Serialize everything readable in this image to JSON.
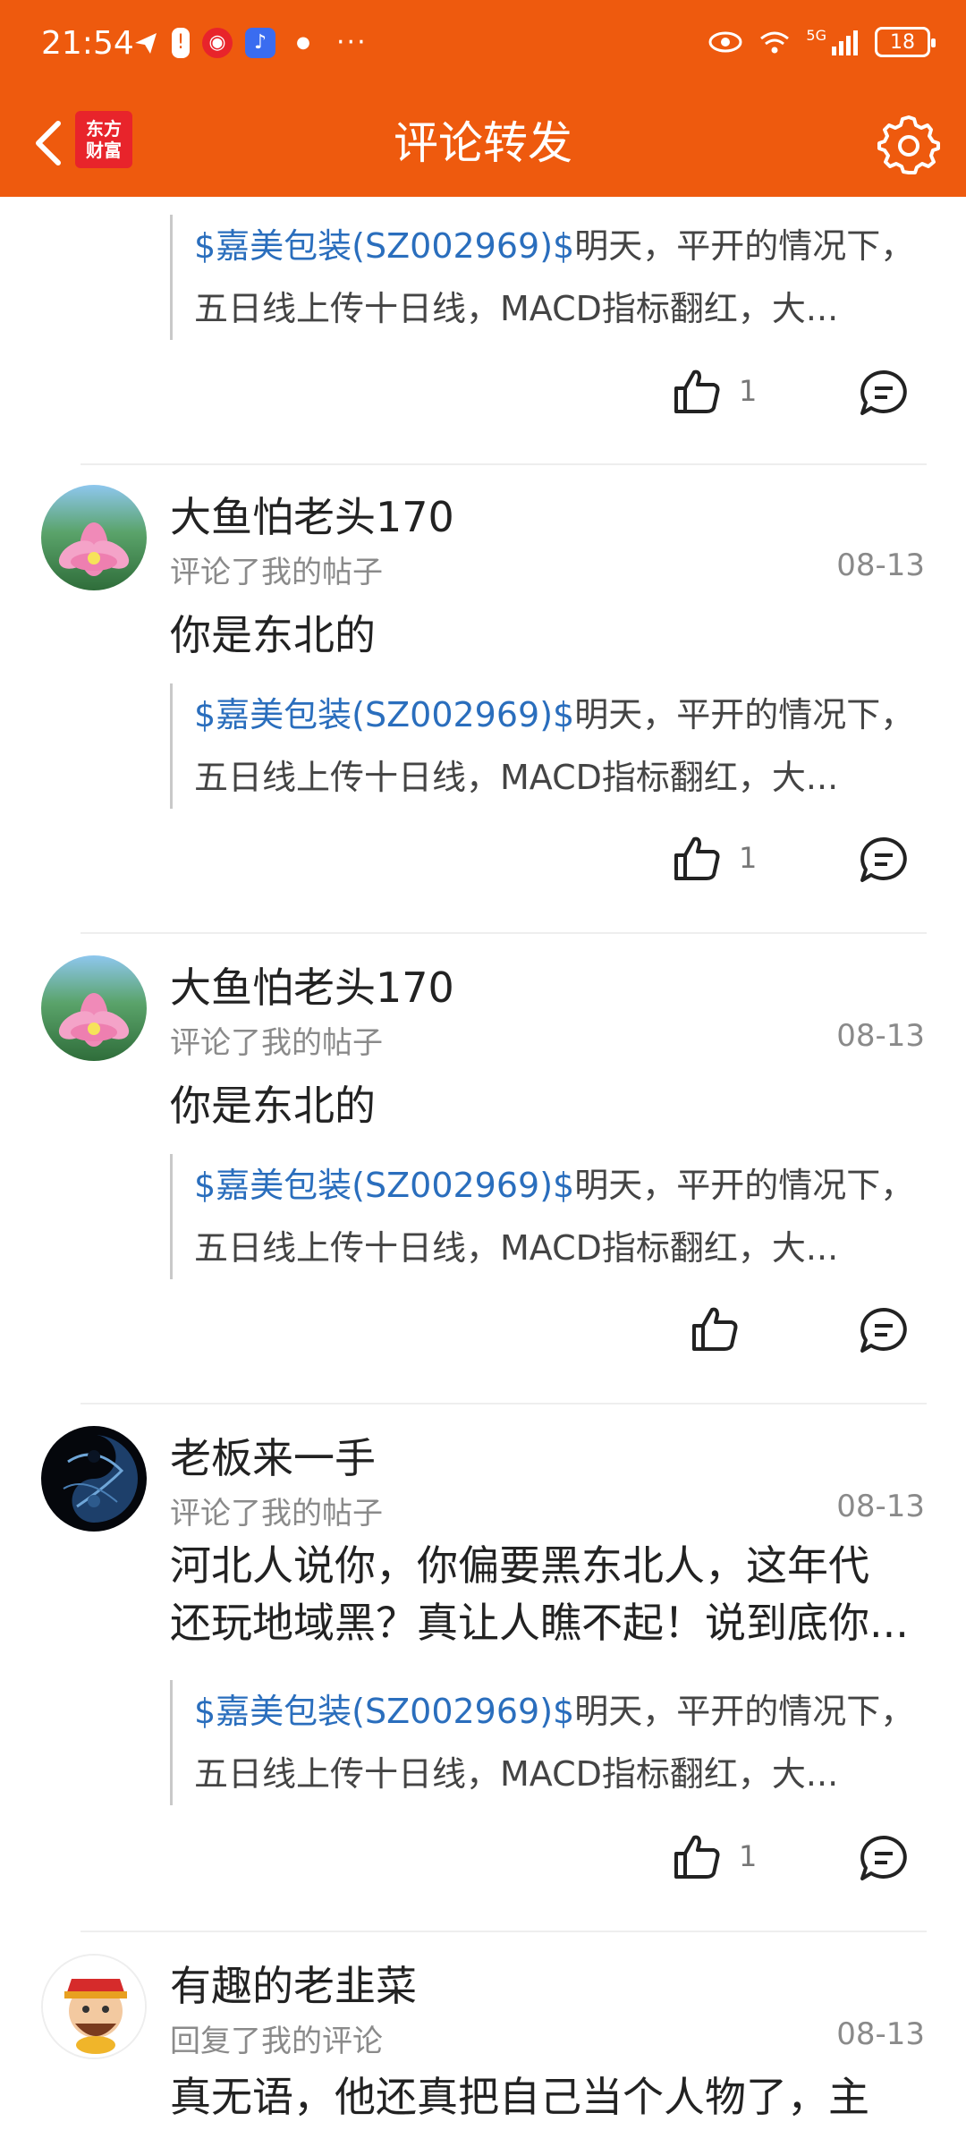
{
  "status_bar": {
    "time": "21:54",
    "left_icons": [
      "paper-plane-icon",
      "exclamation-icon",
      "red-app-icon",
      "music-app-icon",
      "news-app-icon"
    ],
    "more": "···",
    "network": "5G",
    "battery": "18"
  },
  "header": {
    "logo_text_line1": "东方",
    "logo_text_line2": "财富",
    "title": "评论转发",
    "accent_color": "#ee5a0e"
  },
  "feed": [
    {
      "partial": true,
      "quote_stock": "$嘉美包装(SZ002969)$",
      "quote_line1": "明天，平开的情况下，",
      "quote_line2": "五日线上传十日线，MACD指标翻红，大...",
      "like_count": "1"
    },
    {
      "avatar": "lotus",
      "name": "大鱼怕老头170",
      "action": "评论了我的帖子",
      "date": "08-13",
      "comment": "你是东北的",
      "quote_stock": "$嘉美包装(SZ002969)$",
      "quote_line1": "明天，平开的情况下，",
      "quote_line2": "五日线上传十日线，MACD指标翻红，大...",
      "like_count": "1"
    },
    {
      "avatar": "lotus",
      "name": "大鱼怕老头170",
      "action": "评论了我的帖子",
      "date": "08-13",
      "comment": "你是东北的",
      "quote_stock": "$嘉美包装(SZ002969)$",
      "quote_line1": "明天，平开的情况下，",
      "quote_line2": "五日线上传十日线，MACD指标翻红，大...",
      "like_count": ""
    },
    {
      "avatar": "dark-swirl",
      "name": "老板来一手",
      "action": "评论了我的帖子",
      "date": "08-13",
      "comment_line1": "河北人说你，你偏要黑东北人，这年代",
      "comment_line2": "还玩地域黑？真让人瞧不起！说到底你...",
      "quote_stock": "$嘉美包装(SZ002969)$",
      "quote_line1": "明天，平开的情况下，",
      "quote_line2": "五日线上传十日线，MACD指标翻红，大...",
      "like_count": "1"
    },
    {
      "avatar": "fortune-god",
      "name": "有趣的老韭菜",
      "action": "回复了我的评论",
      "date": "08-13",
      "comment_line1": "真无语，他还真把自己当个人物了，主"
    }
  ]
}
